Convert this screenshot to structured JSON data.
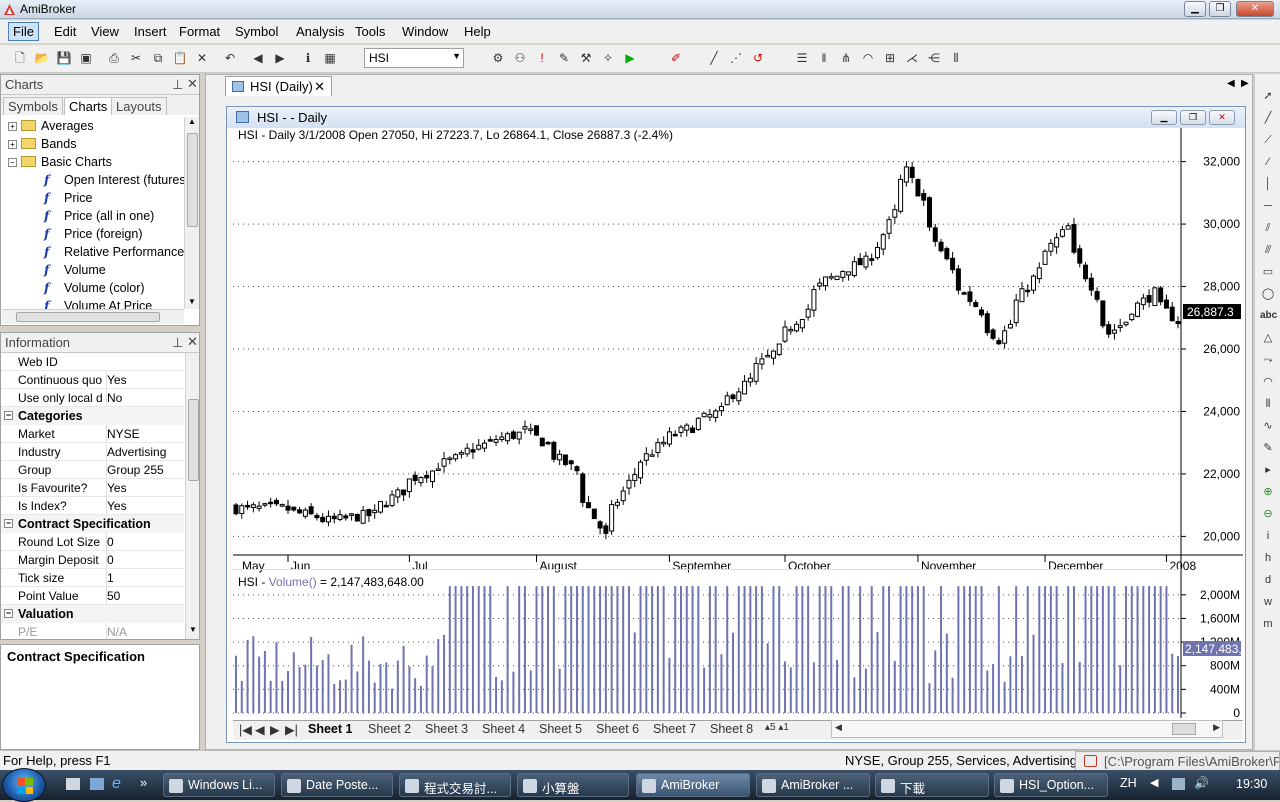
{
  "app": {
    "title": "AmiBroker"
  },
  "menu": [
    "File",
    "Edit",
    "View",
    "Insert",
    "Format",
    "Symbol",
    "Analysis",
    "Tools",
    "Window",
    "Help"
  ],
  "toolbar": {
    "symbol": "HSI"
  },
  "charts_pane": {
    "title": "Charts",
    "tabs": [
      "Symbols",
      "Charts",
      "Layouts"
    ],
    "tree": [
      {
        "label": "Averages",
        "type": "folder"
      },
      {
        "label": "Bands",
        "type": "folder"
      },
      {
        "label": "Basic Charts",
        "type": "folder-open"
      },
      {
        "label": "Open Interest (futures",
        "type": "formula"
      },
      {
        "label": "Price",
        "type": "formula"
      },
      {
        "label": "Price (all in one)",
        "type": "formula"
      },
      {
        "label": "Price (foreign)",
        "type": "formula"
      },
      {
        "label": "Relative Performance",
        "type": "formula"
      },
      {
        "label": "Volume",
        "type": "formula"
      },
      {
        "label": "Volume (color)",
        "type": "formula"
      },
      {
        "label": "Volume At Price",
        "type": "formula"
      }
    ]
  },
  "info_pane": {
    "title": "Information",
    "rows": [
      {
        "kind": "row",
        "k": "Web ID",
        "v": ""
      },
      {
        "kind": "row",
        "k": "Continuous quo",
        "v": "Yes"
      },
      {
        "kind": "row",
        "k": "Use only local d",
        "v": "No"
      },
      {
        "kind": "cat",
        "k": "Categories"
      },
      {
        "kind": "row",
        "k": "Market",
        "v": "NYSE"
      },
      {
        "kind": "row",
        "k": "Industry",
        "v": "Advertising"
      },
      {
        "kind": "row",
        "k": "Group",
        "v": "Group 255"
      },
      {
        "kind": "row",
        "k": "Is Favourite?",
        "v": "Yes"
      },
      {
        "kind": "row",
        "k": "Is Index?",
        "v": "Yes"
      },
      {
        "kind": "cat",
        "k": "Contract Specification"
      },
      {
        "kind": "row",
        "k": "Round Lot Size",
        "v": "0"
      },
      {
        "kind": "row",
        "k": "Margin Deposit",
        "v": "0"
      },
      {
        "kind": "row",
        "k": "Tick size",
        "v": "1"
      },
      {
        "kind": "row",
        "k": "Point Value",
        "v": "50"
      },
      {
        "kind": "cat",
        "k": "Valuation"
      },
      {
        "kind": "row",
        "k": "P/E",
        "v": "N/A",
        "dim": true
      }
    ],
    "description": "Contract Specification"
  },
  "document": {
    "tab": "HSI (Daily)",
    "window_title": "HSI -  - Daily",
    "price_header": "HSI - Daily 3/1/2008 Open 27050, Hi 27223.7, Lo 26864.1, Close 26887.3 (-2.4%)",
    "volume_header_prefix": "HSI - ",
    "volume_header_func": "Volume()",
    "volume_header_value": " = 2,147,483,648.00",
    "sheets": [
      "Sheet 1",
      "Sheet 2",
      "Sheet 3",
      "Sheet 4",
      "Sheet 5",
      "Sheet 6",
      "Sheet 7",
      "Sheet 8"
    ]
  },
  "chart_data": [
    {
      "type": "candlestick",
      "title": "HSI - Daily 3/1/2008 Open 27050, Hi 27223.7, Lo 26864.1, Close 26887.3 (-2.4%)",
      "x_tick_labels": [
        "May",
        "Jun",
        "Jul",
        "August",
        "September",
        "October",
        "November",
        "December",
        "2008"
      ],
      "y_tick_labels": [
        "32,000",
        "30,000",
        "28,000",
        "26,000",
        "24,000",
        "22,000",
        "20,000"
      ],
      "ylim": [
        19500,
        32500
      ],
      "last_value_label": "26,887.3",
      "anchors": [
        {
          "date": "2007-05-31",
          "close": 20900
        },
        {
          "date": "2007-06-12",
          "close": 20500
        },
        {
          "date": "2007-06-22",
          "close": 20700
        },
        {
          "date": "2007-07-03",
          "close": 21900
        },
        {
          "date": "2007-07-20",
          "close": 23000
        },
        {
          "date": "2007-07-30",
          "close": 23400
        },
        {
          "date": "2007-08-10",
          "close": 22100
        },
        {
          "date": "2007-08-17",
          "close": 20000
        },
        {
          "date": "2007-08-24",
          "close": 22000
        },
        {
          "date": "2007-08-31",
          "close": 23000
        },
        {
          "date": "2007-09-14",
          "close": 24000
        },
        {
          "date": "2007-09-28",
          "close": 26000
        },
        {
          "date": "2007-10-10",
          "close": 28200
        },
        {
          "date": "2007-10-22",
          "close": 29000
        },
        {
          "date": "2007-10-30",
          "close": 31700
        },
        {
          "date": "2007-11-09",
          "close": 28500
        },
        {
          "date": "2007-11-21",
          "close": 26300
        },
        {
          "date": "2007-11-30",
          "close": 28500
        },
        {
          "date": "2007-12-07",
          "close": 29900
        },
        {
          "date": "2007-12-18",
          "close": 26500
        },
        {
          "date": "2007-12-28",
          "close": 27800
        },
        {
          "date": "2008-01-03",
          "close": 26887.3
        }
      ]
    },
    {
      "type": "bar",
      "title": "HSI - Volume() = 2,147,483,648.00",
      "y_tick_labels": [
        "2,000M",
        "1,600M",
        "1,200M",
        "800M",
        "400M",
        "0"
      ],
      "ylim": [
        0,
        2200
      ],
      "unit": "M",
      "last_value_label": "2,147,483,",
      "typical_value": 2147
    }
  ],
  "statusbar": {
    "help": "For Help, press F1",
    "info": "NYSE, Group 255, Services, Advertising",
    "path": "[C:\\Program Files\\AmiBroker\\Fo"
  },
  "taskbar": {
    "items": [
      "Windows Li...",
      "Date Poste...",
      "程式交易討...",
      "小算盤",
      "AmiBroker",
      "AmiBroker ...",
      "下載",
      "HSI_Option..."
    ],
    "lang": "ZH",
    "clock": "19:30"
  },
  "colors": {
    "volume_bar": "#6f74b0",
    "candle": "#000000",
    "accent": "#1d5aa8"
  }
}
